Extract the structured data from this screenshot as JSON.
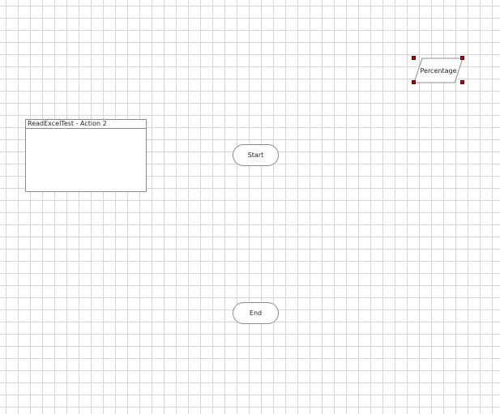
{
  "canvas": {
    "grid_color": "#d4d4d4",
    "background_color": "#ffffff"
  },
  "page_box": {
    "title": "ReadExcelTest - Action 2"
  },
  "terminals": {
    "start_label": "Start",
    "end_label": "End"
  },
  "data_shape": {
    "label": "Percentage",
    "selected": true,
    "handle_color": "#a01010"
  }
}
